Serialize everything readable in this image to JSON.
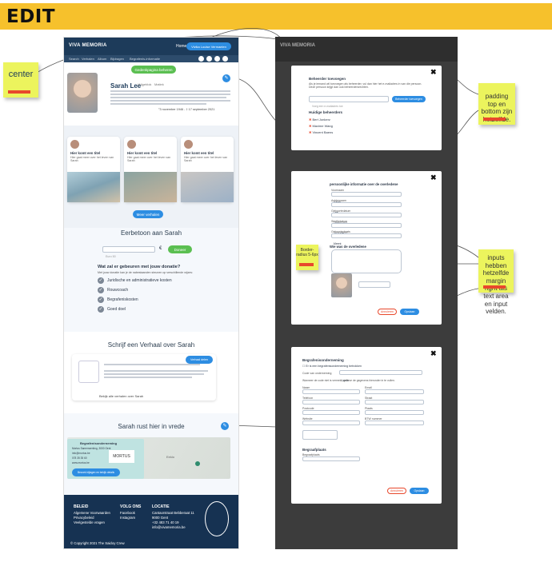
{
  "header": {
    "title": "EDIT"
  },
  "notes": {
    "center": "center",
    "padding": "padding top en bottom zijn hetzelfde.",
    "inputs": "inputs hebben hetzelfde margin right als text area en input velden.",
    "border": "Border-radius 5-6px"
  },
  "site": {
    "logo": "VIVA MEMORIA",
    "nav_home": "Home",
    "nav_user": "Vivika Louise Vermaelen",
    "menu": [
      "Search",
      "Verhalen",
      "Album",
      "Bijdragen",
      "Begrafenis-informatie"
    ],
    "edit_button": "Gedenkpagina beheren",
    "profile": {
      "name": "Sarah Lee",
      "dates": "°3 november 1946 - † 17 september 2021",
      "tags": [
        "Vrijgeblok",
        "Matiek"
      ]
    },
    "stories": [
      {
        "title": "Hier komt een titel",
        "text": "Hier gaat meer over het leven van Sarah",
        "date": "Wachten"
      },
      {
        "title": "Hier komt een titel",
        "text": "Hier gaat meer over het leven van Sarah",
        "date": "Wachten"
      },
      {
        "title": "Hier komt een titel",
        "text": "Hier gaat meer over het leven van Sarah",
        "date": "Wachten"
      }
    ],
    "more_stories": "Meer verhalen",
    "tribute": {
      "title": "Eerbetoon aan Sarah",
      "amount_placeholder": "Euro 50",
      "currency": "€",
      "donate": "Doneer",
      "question": "Wat zal er gebeuren met jouw donatie?",
      "intro": "Met jouw donatie kan je de nabestaanden steunen op verschillende wijzes:",
      "items": [
        "Juridische en administratieve kosten",
        "Rouwcoach",
        "Begrafeniskosten",
        "Goed doel"
      ]
    },
    "write": {
      "title": "Schrijf een Verhaal over Sarah",
      "button": "Verhaal delen",
      "link": "Bekijk alle verhalen over Sarah"
    },
    "rest": {
      "title": "Sarah rust hier in vrede",
      "card_title": "Begrafenisonderneming",
      "lines": [
        "Mortus Samenwerking, 3000 Gent",
        "info@mortus.be",
        "078 35 35 60",
        "www.mortus.be"
      ],
      "cta": "Bezoek bijlagen en bekijk details",
      "brand": "MORTUS",
      "map_label": "Eeklo"
    },
    "footer": {
      "col1_title": "BELEID",
      "col1": [
        "Algemene Voorwaarden",
        "Privacybeleid",
        "Veelgestelde vragen"
      ],
      "col2_title": "VOLG ONS",
      "col2": [
        "Facebook",
        "Instagram"
      ],
      "col3_title": "LOCATIE",
      "col3": [
        "Cantaorstraat Bebberaat 11",
        "9000 Gent",
        "+32 483 71 40 19",
        "info@vivamemoria.be"
      ],
      "copyright": "© Copyright 2021 The Saidoy Crew"
    }
  },
  "modal1": {
    "title": "Beheerder toevoegen",
    "body": "Als je iemand wil toevoegen als beheerder, vul dan hier het e-mailadres in van die persoon. Deze persoon krijgt dan ook beheerdersrechten.",
    "placeholder": "Voeg een e-mailadres toe",
    "button": "Beheerder toevoegen",
    "list_title": "Huidige beheerders",
    "admins": [
      "Bert Jonkerz",
      "Maxime Wang",
      "Vincent Baens"
    ]
  },
  "modal2": {
    "title": "persoonlijke informatie over de overledene",
    "fields": [
      "Voornaam",
      "Achternaam",
      "Geboortedatum",
      "Sterftedatum",
      "Geboorteplaats"
    ],
    "values": [
      "Sarah",
      "Lee",
      "1946/11/03",
      "2021/09/17",
      "Meent"
    ],
    "story_title": "Wie was de overledene",
    "cancel": "Annuleren",
    "save": "Opslaan"
  },
  "modal3": {
    "title": "Begrafenisonderneming",
    "check": "Er is een begrafenisonderneming betrokken",
    "code_label": "Code van onderneming",
    "code_value": "Leeds",
    "hint": "Wanneer de code niet is vermeld, gelieve de gegevens hieronder in te vullen.",
    "fields": [
      "Naam",
      "Email",
      "Telefoon",
      "Straat",
      "Postcode",
      "Plaats",
      "Website",
      "BTW nummer"
    ],
    "section2": "Begraafplaats",
    "section2_label": "Begraafplaats",
    "cancel": "Annuleren",
    "save": "Opslaan"
  },
  "colors": {
    "accent": "#2d8de2",
    "brand_dark": "#1d3b5a",
    "note_yellow": "#ecf45d",
    "header": "#f6c12c"
  }
}
